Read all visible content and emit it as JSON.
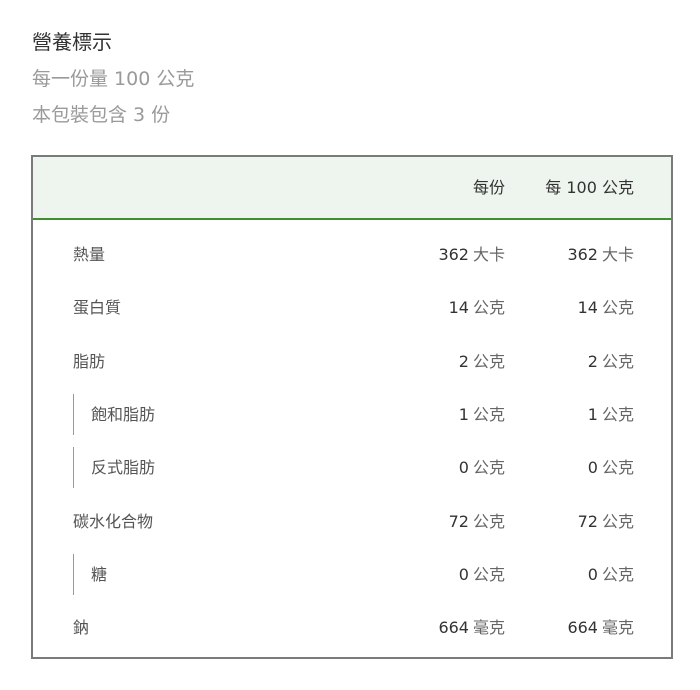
{
  "title": "營養標示",
  "serving_size": "每一份量 100 公克",
  "servings_per_package": "本包裝包含 3 份",
  "columns": {
    "per_serving": "每份",
    "per_100g": "每 100 公克"
  },
  "rows": [
    {
      "label": "熱量",
      "serving_value": "362",
      "serving_unit": "大卡",
      "per100_value": "362",
      "per100_unit": "大卡",
      "indent": false
    },
    {
      "label": "蛋白質",
      "serving_value": "14",
      "serving_unit": "公克",
      "per100_value": "14",
      "per100_unit": "公克",
      "indent": false
    },
    {
      "label": "脂肪",
      "serving_value": "2",
      "serving_unit": "公克",
      "per100_value": "2",
      "per100_unit": "公克",
      "indent": false
    },
    {
      "label": "飽和脂肪",
      "serving_value": "1",
      "serving_unit": "公克",
      "per100_value": "1",
      "per100_unit": "公克",
      "indent": true
    },
    {
      "label": "反式脂肪",
      "serving_value": "0",
      "serving_unit": "公克",
      "per100_value": "0",
      "per100_unit": "公克",
      "indent": true
    },
    {
      "label": "碳水化合物",
      "serving_value": "72",
      "serving_unit": "公克",
      "per100_value": "72",
      "per100_unit": "公克",
      "indent": false
    },
    {
      "label": "糖",
      "serving_value": "0",
      "serving_unit": "公克",
      "per100_value": "0",
      "per100_unit": "公克",
      "indent": true
    },
    {
      "label": "鈉",
      "serving_value": "664",
      "serving_unit": "毫克",
      "per100_value": "664",
      "per100_unit": "毫克",
      "indent": false
    }
  ]
}
